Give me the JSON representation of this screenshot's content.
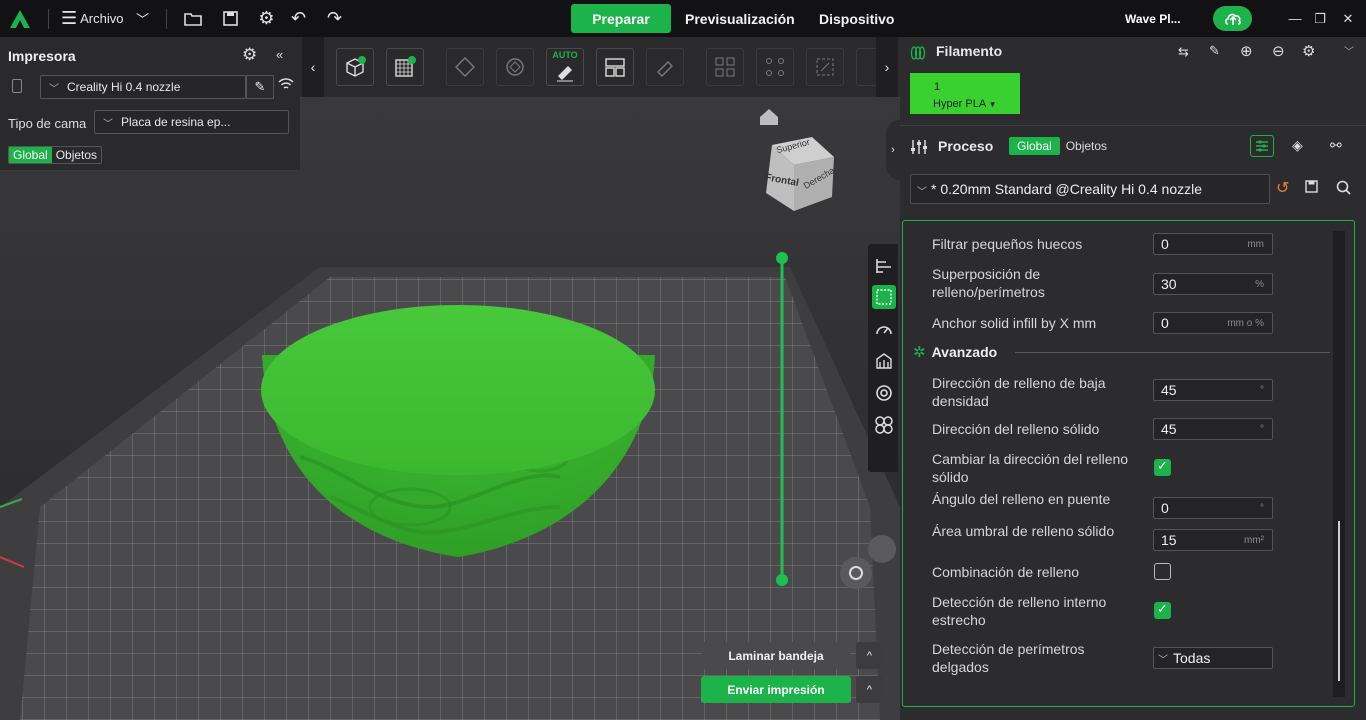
{
  "topbar": {
    "file_menu": "Archivo",
    "tabs": [
      "Preparar",
      "Previsualización",
      "Dispositivo"
    ],
    "printer_name": "Wave Pl...",
    "window_controls": [
      "minimize-icon",
      "restore-icon",
      "close-icon"
    ]
  },
  "printer_panel": {
    "title": "Impresora",
    "printer": "Creality Hi 0.4 nozzle",
    "bed_label": "Tipo de cama",
    "bed_value": "Placa de resina ep...",
    "tabs": [
      "Global",
      "Objetos"
    ]
  },
  "viewcube": {
    "top": "Superior",
    "front": "Frontal",
    "right": "Derecha"
  },
  "toolbar": {
    "auto_label": "AUTO"
  },
  "filament": {
    "title": "Filamento",
    "slot_number": "1",
    "slot_name": "Hyper PLA",
    "slot_color": "#38d12f"
  },
  "process": {
    "title": "Proceso",
    "tabs": [
      "Global",
      "Objetos"
    ],
    "profile": "* 0.20mm Standard @Creality Hi 0.4 nozzle"
  },
  "settings": {
    "rows": [
      {
        "label": "Filtrar pequeños huecos",
        "value": "0",
        "unit": "mm"
      },
      {
        "label": "Superposición de relleno/perímetros",
        "value": "30",
        "unit": "%"
      },
      {
        "label": "Anchor solid infill by X mm",
        "value": "0",
        "unit": "mm o %"
      }
    ],
    "section_title": "Avanzado",
    "advanced": [
      {
        "label": "Dirección de relleno de baja densidad",
        "value": "45",
        "unit": "°"
      },
      {
        "label": "Dirección del relleno sólido",
        "value": "45",
        "unit": "°"
      },
      {
        "label": "Cambiar la dirección del relleno sólido",
        "checked": true
      },
      {
        "label": "Ángulo del relleno en puente",
        "value": "0",
        "unit": "°"
      },
      {
        "label": "Área umbral de relleno sólido",
        "value": "15",
        "unit": "mm²"
      },
      {
        "label": "Combinación de relleno",
        "checked": false
      },
      {
        "label": "Detección de relleno interno estrecho",
        "checked": true
      },
      {
        "label": "Detección de perímetros delgados",
        "value": "Todas"
      }
    ]
  },
  "actions": {
    "slice": "Laminar bandeja",
    "print": "Enviar impresión",
    "caret": "^"
  },
  "colors": {
    "accent": "#1bb34a",
    "model": "#3dbf32"
  }
}
